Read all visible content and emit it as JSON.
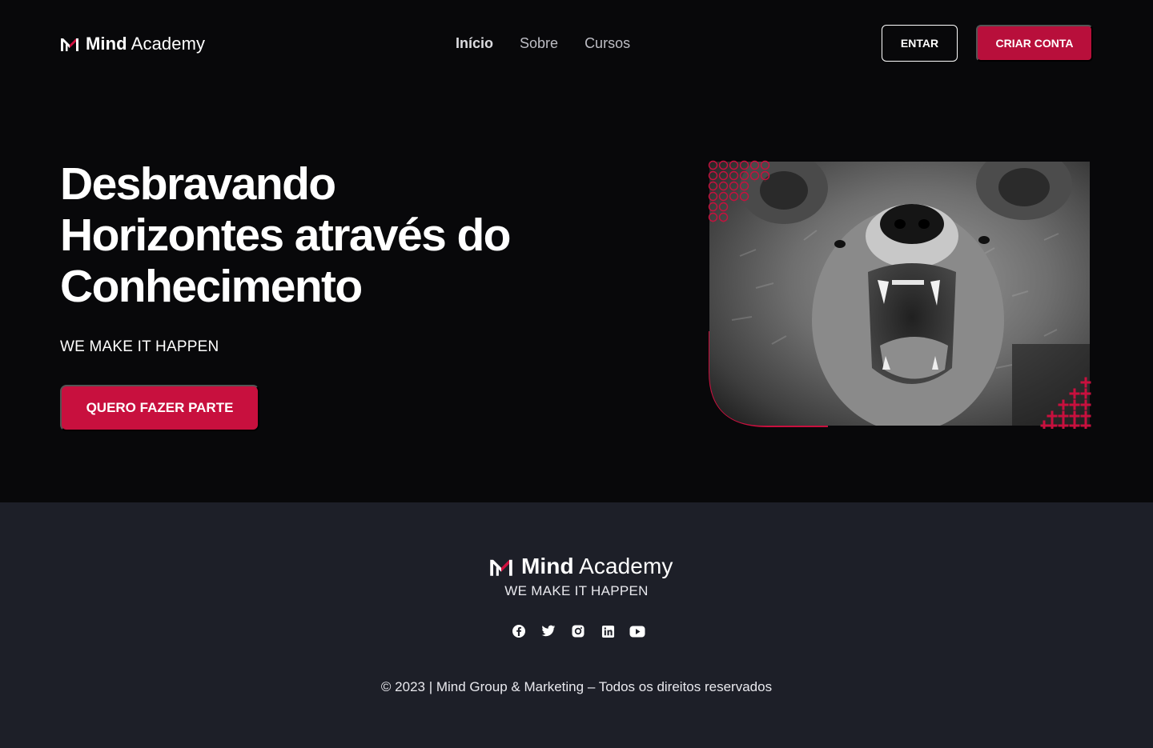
{
  "header": {
    "brand_bold": "Mind",
    "brand_light": "Academy",
    "nav": [
      {
        "label": "Início",
        "active": true
      },
      {
        "label": "Sobre",
        "active": false
      },
      {
        "label": "Cursos",
        "active": false
      }
    ],
    "login_label": "ENTAR",
    "signup_label": "CRIAR CONTA"
  },
  "hero": {
    "headline": "Desbravando Horizontes através do Conhecimento",
    "tagline": "WE MAKE IT HAPPEN",
    "cta_label": "QUERO FAZER PARTE",
    "image_icon": "bear-photo"
  },
  "footer": {
    "brand_bold": "Mind",
    "brand_light": "Academy",
    "tagline": "WE MAKE IT HAPPEN",
    "socials": [
      "facebook-icon",
      "twitter-icon",
      "instagram-icon",
      "linkedin-icon",
      "youtube-icon"
    ],
    "copyright": "© 2023 | Mind Group & Marketing – Todos os direitos reservados"
  },
  "colors": {
    "accent": "#c8103e",
    "hero_bg": "#08080a",
    "footer_bg": "#1d1f28"
  }
}
